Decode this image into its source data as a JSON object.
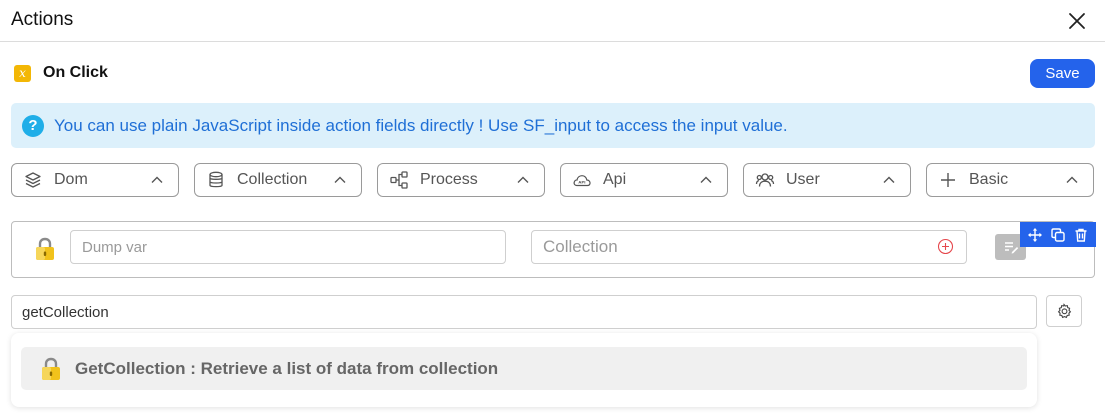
{
  "header": {
    "title": "Actions",
    "close_icon": "close-icon"
  },
  "event": {
    "badge_icon": "javascript-x-icon",
    "label": "On Click"
  },
  "toolbar": {
    "save_label": "Save",
    "accent_color": "#2463eb"
  },
  "info": {
    "icon": "question-circle-icon",
    "text": "You can use plain JavaScript inside action fields directly ! Use SF_input to access the input value.",
    "background": "#dcf0fb",
    "text_color": "#1f6fd6"
  },
  "categories": [
    {
      "label": "Dom",
      "icon": "layers-icon"
    },
    {
      "label": "Collection",
      "icon": "database-icon"
    },
    {
      "label": "Process",
      "icon": "process-flow-icon"
    },
    {
      "label": "Api",
      "icon": "cloud-api-icon"
    },
    {
      "label": "User",
      "icon": "users-icon"
    },
    {
      "label": "Basic",
      "icon": "plus-icon"
    }
  ],
  "action_card": {
    "dump_placeholder": "Dump var",
    "dump_value": "",
    "collection_placeholder": "Collection",
    "collection_value": "",
    "lock_icon": "lock-icon",
    "add_icon": "plus-circle-icon",
    "edit_icon": "edit-note-icon",
    "tools": [
      "move-icon",
      "duplicate-icon",
      "trash-icon"
    ]
  },
  "search": {
    "value": "getCollection",
    "settings_icon": "settings-icon"
  },
  "suggestions": [
    {
      "label": "GetCollection : Retrieve a list of data from collection",
      "icon": "lock-icon"
    }
  ]
}
